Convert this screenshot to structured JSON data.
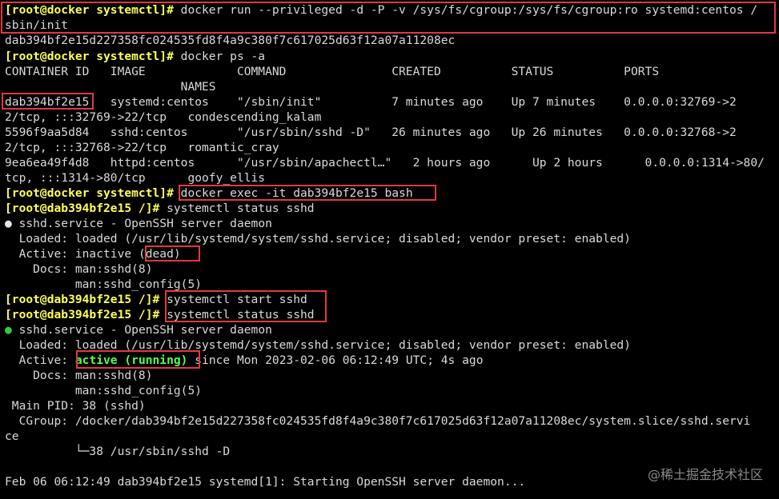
{
  "prompt_docker": "[root@docker systemctl]#",
  "prompt_container": "[root@dab394bf2e15 /]#",
  "bullet": "●",
  "lines": {
    "l0": " docker run --privileged -d -P -v /sys/fs/cgroup:/sys/fs/cgroup:ro systemd:centos /",
    "l1": "sbin/init",
    "l2": "dab394bf2e15d227358fc024535fd8f4a9c380f7c617025d63f12a07a11208ec",
    "l3": " docker ps -a",
    "l4": "CONTAINER ID   IMAGE             COMMAND               CREATED          STATUS          PORTS",
    "l5": "                         NAMES",
    "l6": "dab394bf2e15   systemd:centos    \"/sbin/init\"          7 minutes ago    Up 7 minutes    0.0.0.0:32769->2",
    "l7": "2/tcp, :::32769->22/tcp   condescending_kalam",
    "l8": "5596f9aa5d84   sshd:centos       \"/usr/sbin/sshd -D\"   26 minutes ago   Up 26 minutes   0.0.0.0:32768->2",
    "l9": "2/tcp, :::32768->22/tcp   romantic_cray",
    "l10": "9ea6ea49f4d8   httpd:centos      \"/usr/sbin/apachectl…\"   2 hours ago      Up 2 hours      0.0.0.0:1314->80/",
    "l11": "tcp, :::1314->80/tcp      goofy_ellis",
    "l12": " docker exec -it dab394bf2e15 bash",
    "l13": " systemctl status sshd",
    "l14": " sshd.service - OpenSSH server daemon",
    "l15": "  Loaded: loaded (/usr/lib/systemd/system/sshd.service; disabled; vendor preset: enabled)",
    "l16a": "  Active: inactive ",
    "l16b": "(dead)",
    "l17": "    Docs: man:sshd(8)",
    "l18": "          man:sshd_config(5)",
    "l19": " systemctl start sshd",
    "l20": " systemctl status sshd",
    "l21": " sshd.service - OpenSSH server daemon",
    "l22": "  Loaded: loaded (/usr/lib/systemd/system/sshd.service; disabled; vendor preset: enabled)",
    "l23a": "  Active: ",
    "l23b": "active (running)",
    "l23c": " since Mon 2023-02-06 06:12:49 UTC; 4s ago",
    "l24": "    Docs: man:sshd(8)",
    "l25": "          man:sshd_config(5)",
    "l26": " Main PID: 38 (sshd)",
    "l27": "  CGroup: /docker/dab394bf2e15d227358fc024535fd8f4a9c380f7c617025d63f12a07a11208ec/system.slice/sshd.servi",
    "l28": "ce",
    "l29": "          └─38 /usr/sbin/sshd -D",
    "l30": "",
    "l31": "Feb 06 06:12:49 dab394bf2e15 systemd[1]: Starting OpenSSH server daemon..."
  },
  "watermark": "@稀土掘金技术社区",
  "colors": {
    "background": "#000000",
    "text": "#d9d9d9",
    "prompt": "#ffff55",
    "active": "#55ff55",
    "highlight_box": "#e0393e"
  }
}
